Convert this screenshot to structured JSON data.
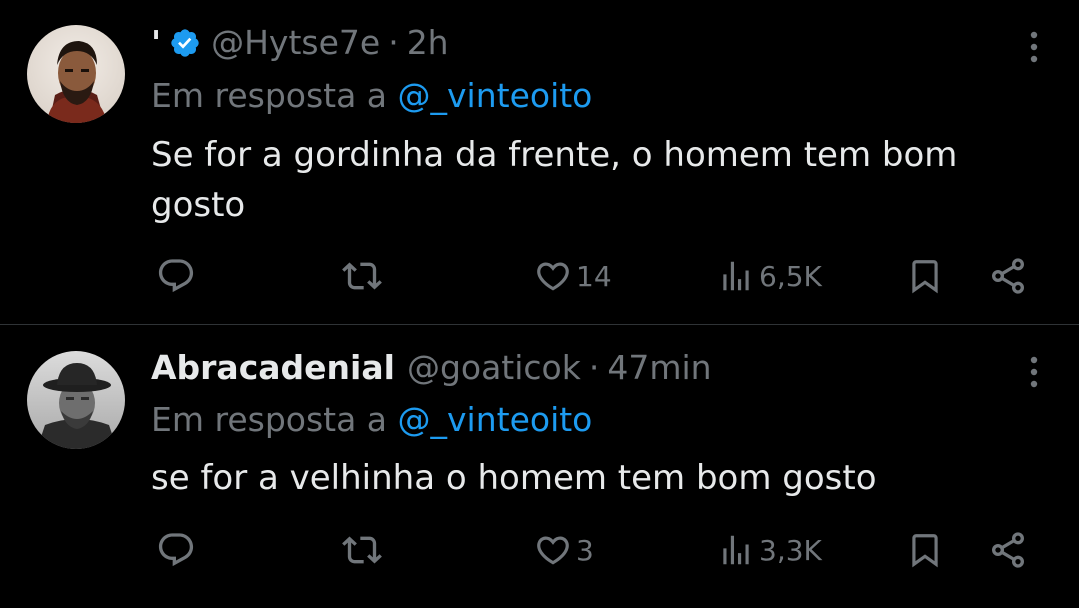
{
  "tweets": [
    {
      "display_name": "'",
      "verified": true,
      "handle": "@Hytse7e",
      "separator": "·",
      "time": "2h",
      "reply_prefix": "Em resposta a",
      "reply_to": "@_vinteoito",
      "text": "Se for a gordinha da frente, o homem tem bom gosto",
      "likes": "14",
      "views": "6,5K"
    },
    {
      "display_name": "Abracadenial",
      "verified": false,
      "handle": "@goaticok",
      "separator": "·",
      "time": "47min",
      "reply_prefix": "Em resposta a",
      "reply_to": "@_vinteoito",
      "text": "se for a velhinha o homem tem bom gosto",
      "likes": "3",
      "views": "3,3K"
    }
  ],
  "colors": {
    "background": "#000000",
    "text": "#e7e9ea",
    "muted": "#71767b",
    "accent": "#1d9bf0",
    "divider": "#2f3336"
  },
  "icons": [
    "verified-badge-icon",
    "more-options-icon",
    "reply-icon",
    "repost-icon",
    "like-icon",
    "views-icon",
    "bookmark-icon",
    "share-icon"
  ]
}
